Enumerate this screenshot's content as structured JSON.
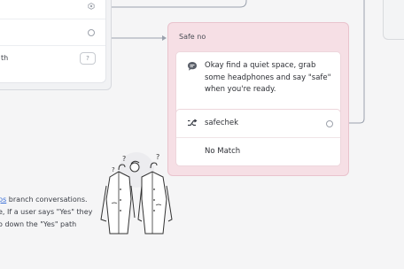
{
  "left_block": {
    "path_text": "th",
    "help_icon": "?"
  },
  "safe_no_block": {
    "title": "Safe no",
    "message": "Okay find a quiet space, grab some headphones and say \"safe\" when you're ready.",
    "choices": [
      {
        "label": "safechek",
        "icon": "intent-shuffle-icon"
      },
      {
        "label": "No Match",
        "icon": ""
      }
    ]
  },
  "help": {
    "link_text": "ps",
    "line1_rest": " branch conversations.",
    "line2": "e, If a user says \"Yes\" they",
    "line3": "o down the \"Yes\" path"
  },
  "colors": {
    "block_bg": "#f6dfe5",
    "block_border": "#e9c3cd",
    "connector": "#9aa1ad",
    "link": "#3a6fd8"
  }
}
